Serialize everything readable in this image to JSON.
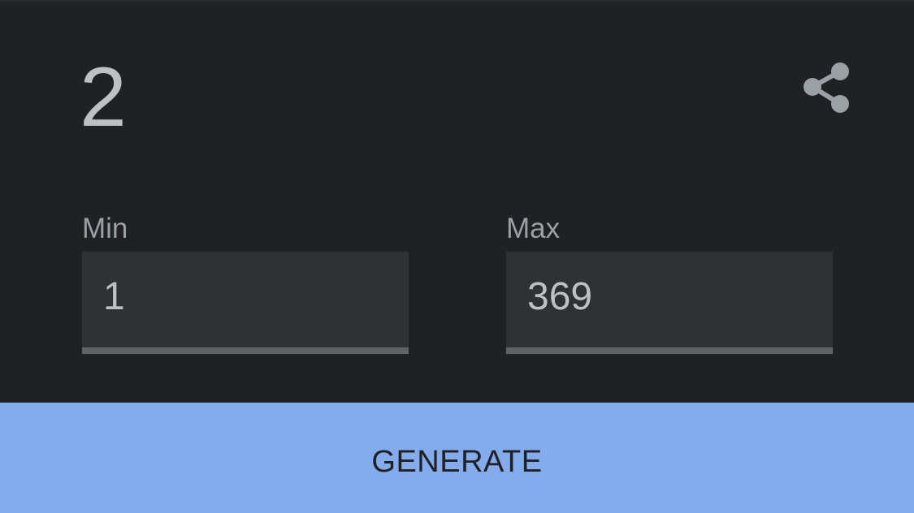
{
  "result": {
    "value": "2"
  },
  "share": {
    "icon": "share-icon",
    "color": "#9aa0a6"
  },
  "min": {
    "label": "Min",
    "value": "1"
  },
  "max": {
    "label": "Max",
    "value": "369"
  },
  "generate": {
    "label": "GENERATE",
    "background": "#8ab4f8"
  },
  "colors": {
    "background": "#202124",
    "field_background": "#303134",
    "text": "#bdc1c6",
    "label": "#9aa0a6",
    "underline": "#5f6368"
  }
}
